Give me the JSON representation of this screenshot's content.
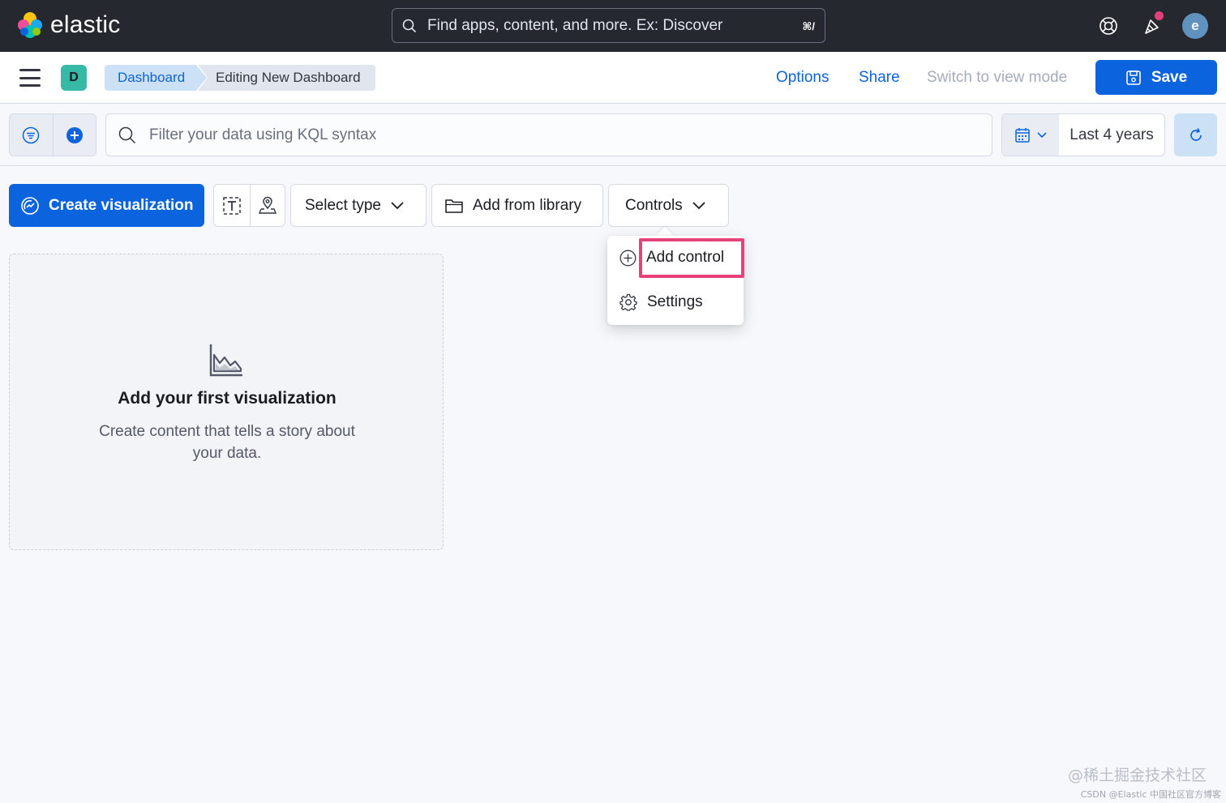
{
  "topbar": {
    "logo_text": "elastic",
    "search_placeholder": "Find apps, content, and more. Ex: Discover",
    "search_shortcut": "⌘/",
    "avatar_initial": "e",
    "icons": [
      "help-icon",
      "newsfeed-icon"
    ]
  },
  "header": {
    "space_initial": "D",
    "breadcrumbs": [
      "Dashboard",
      "Editing New Dashboard"
    ],
    "options_label": "Options",
    "share_label": "Share",
    "switch_mode_label": "Switch to view mode",
    "save_label": "Save"
  },
  "query": {
    "placeholder": "Filter your data using KQL syntax",
    "time_range": "Last 4 years"
  },
  "toolbar": {
    "create_label": "Create visualization",
    "select_type_label": "Select type",
    "add_library_label": "Add from library",
    "controls_label": "Controls"
  },
  "controls_menu": {
    "items": [
      "Add control",
      "Settings"
    ]
  },
  "empty_state": {
    "title": "Add your first visualization",
    "description": "Create content that tells a story about your data."
  },
  "watermark": {
    "line1": "@稀土掘金技术社区",
    "line2": "CSDN @Elastic 中国社区官方博客"
  },
  "colors": {
    "primary": "#0b64dd",
    "topbar": "#25282f",
    "highlight": "#e7417a"
  }
}
